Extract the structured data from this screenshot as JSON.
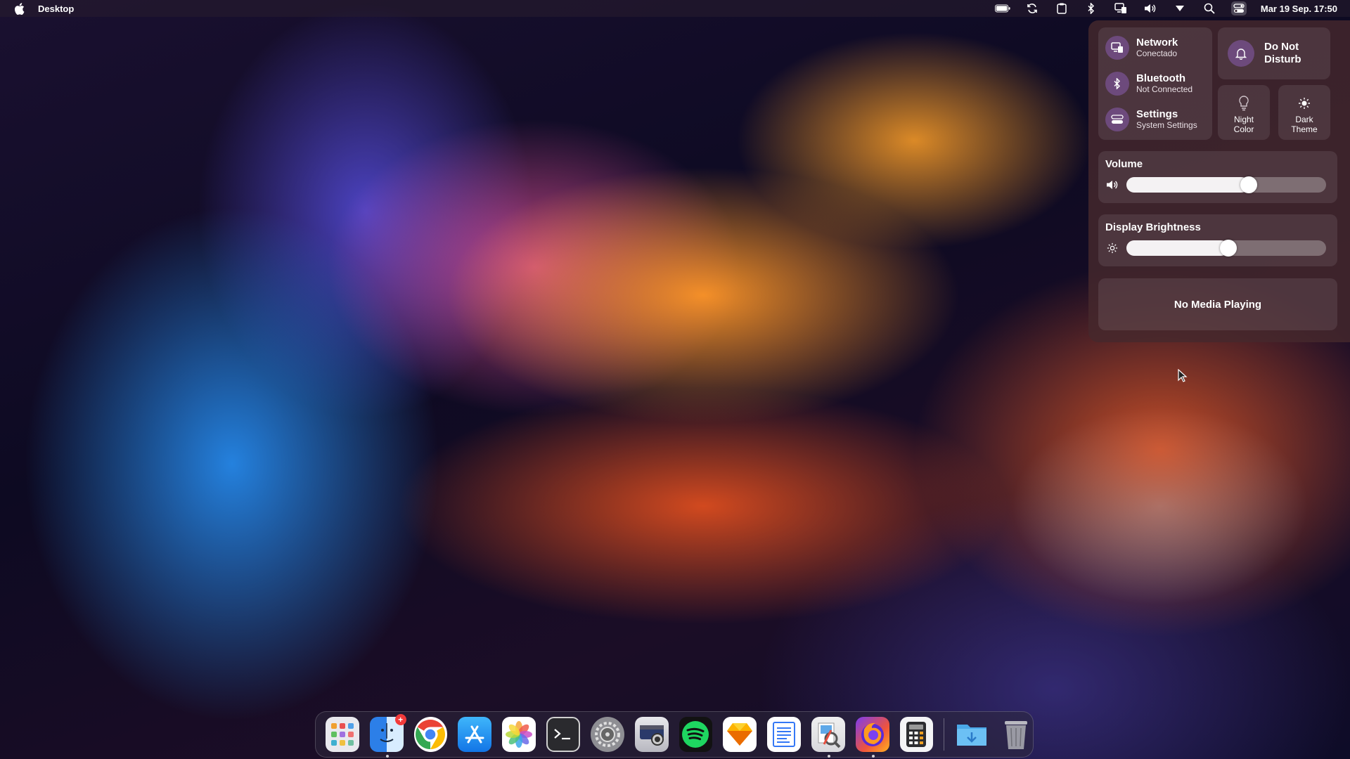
{
  "menubar": {
    "app_name": "Desktop",
    "clock": "Mar 19 Sep. 17:50",
    "icons": [
      "apple-logo",
      "battery-icon",
      "sync-icon",
      "clipboard-icon",
      "bluetooth-icon",
      "display-icon",
      "volume-icon",
      "dropdown-triangle-icon",
      "search-icon",
      "control-center-icon"
    ]
  },
  "control_center": {
    "network": {
      "title": "Network",
      "status": "Conectado"
    },
    "bluetooth": {
      "title": "Bluetooth",
      "status": "Not Connected"
    },
    "settings": {
      "title": "Settings",
      "subtitle": "System Settings"
    },
    "dnd": {
      "line1": "Do Not",
      "line2": "Disturb"
    },
    "night_color": {
      "line1": "Night",
      "line2": "Color"
    },
    "dark_theme": {
      "line1": "Dark",
      "line2": "Theme"
    },
    "volume": {
      "label": "Volume",
      "level": 0.57
    },
    "brightness": {
      "label": "Display Brightness",
      "level": 0.47
    },
    "media": {
      "label": "No Media Playing"
    },
    "accent": "#9664c8"
  },
  "dock": {
    "apps": [
      {
        "name": "Launchpad",
        "running": false
      },
      {
        "name": "Finder",
        "running": true,
        "badge": "+"
      },
      {
        "name": "Chrome",
        "running": false
      },
      {
        "name": "App Store",
        "running": false
      },
      {
        "name": "Photos",
        "running": false
      },
      {
        "name": "Terminal",
        "running": false
      },
      {
        "name": "System Settings",
        "running": false
      },
      {
        "name": "Screenshot",
        "running": false
      },
      {
        "name": "Spotify",
        "running": false
      },
      {
        "name": "Sketch",
        "running": false
      },
      {
        "name": "TextEdit",
        "running": false
      },
      {
        "name": "Preview",
        "running": true
      },
      {
        "name": "Firefox",
        "running": true
      },
      {
        "name": "Calculator",
        "running": false
      },
      {
        "name": "Downloads",
        "running": false
      },
      {
        "name": "Trash",
        "running": false
      }
    ]
  }
}
